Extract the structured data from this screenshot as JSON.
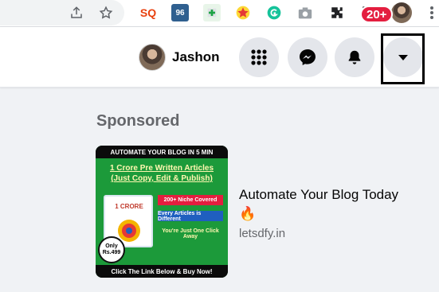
{
  "facebook": {
    "profile_name": "Jashon",
    "notification_badge": "20+"
  },
  "sponsored": {
    "heading": "Sponsored",
    "ad": {
      "title": "Automate Your Blog Today",
      "title_emoji": "🔥",
      "domain": "letsdfy.in",
      "image": {
        "top_banner": "AUTOMATE YOUR BLOG IN 5 MIN",
        "headline_line1": "1 Crore Pre Written Articles",
        "headline_line2": "(Just Copy, Edit & Publish)",
        "product_title": "1 CRORE",
        "tag_niche": "200+ Niche Covered",
        "tag_different": "Every Articles is Different",
        "tag_click": "You're Just One Click Away",
        "price_line1": "Only",
        "price_line2": "Rs.499",
        "bottom_banner": "Click The Link Below & Buy Now!"
      }
    }
  },
  "colors": {
    "fb_grey_button": "#e4e6eb",
    "notification_red": "#e41e3f",
    "page_background": "#f0f2f5"
  }
}
